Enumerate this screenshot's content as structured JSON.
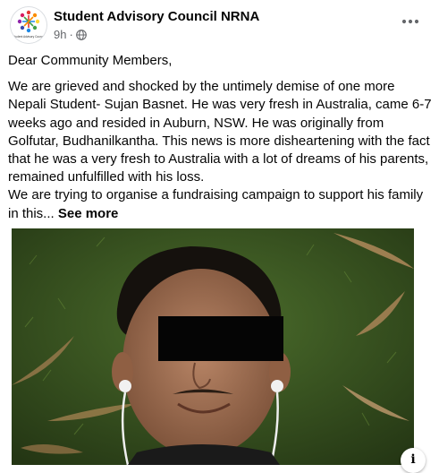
{
  "post": {
    "page_name": "Student Advisory Council NRNA",
    "time": "9h",
    "separator": "·",
    "visibility_icon": "globe-icon",
    "more_icon": "more-horizontal-icon",
    "avatar_caption": "Student Advisory Council",
    "greeting": "Dear Community Members,",
    "paragraph_lines": [
      "We are grieved and shocked by the untimely demise of one more",
      "Nepali Student- Sujan Basnet. He was very fresh in Australia, came 6-7",
      "weeks ago and resided in Auburn, NSW. He was originally from",
      "Golfutar, Budhanilkantha. This news is more disheartening with the fact",
      "that he was a very fresh to Australia with a lot of dreams of his parents,",
      "remained unfulfilled with his loss.",
      "We are trying to organise a fundraising campaign to support his family",
      "in this..."
    ],
    "see_more": "See more",
    "info_label": "i",
    "info_icon": "info-icon"
  },
  "colors": {
    "text_primary": "#050505",
    "text_secondary": "#65676b",
    "background": "#ffffff",
    "photo_grass": "#3a5a22"
  }
}
